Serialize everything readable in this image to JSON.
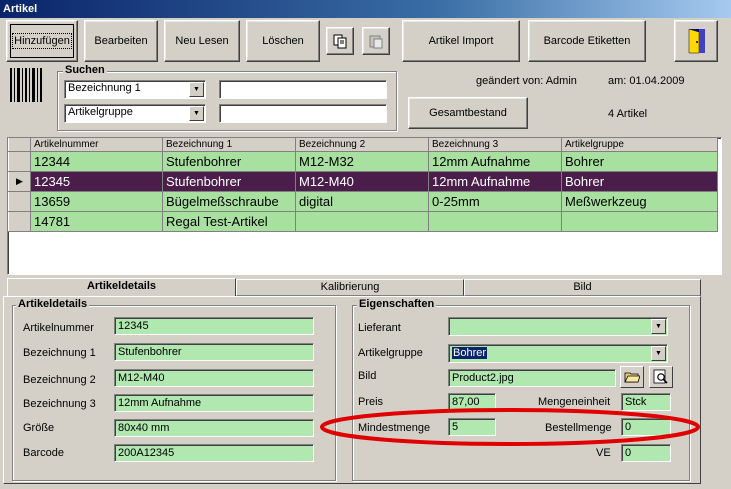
{
  "window": {
    "title": "Artikel"
  },
  "toolbar": {
    "add": "Hinzufügen",
    "edit": "Bearbeiten",
    "reload": "Neu Lesen",
    "delete": "Löschen",
    "import": "Artikel Import",
    "barcode": "Barcode Etiketten"
  },
  "search": {
    "title": "Suchen",
    "field1": "Bezeichnung 1",
    "value1": "",
    "field2": "Artikelgruppe",
    "value2": ""
  },
  "meta": {
    "changed_by": "geändert von: Admin",
    "changed_on": "am: 01.04.2009",
    "total_button": "Gesamtbestand",
    "count": "4 Artikel"
  },
  "grid": {
    "columns": [
      "Artikelnummer",
      "Bezeichnung 1",
      "Bezeichnung 2",
      "Bezeichnung 3",
      "Artikelgruppe"
    ],
    "rows": [
      [
        "12344",
        "Stufenbohrer",
        "M12-M32",
        "12mm Aufnahme",
        "Bohrer"
      ],
      [
        "12345",
        "Stufenbohrer",
        "M12-M40",
        "12mm Aufnahme",
        "Bohrer"
      ],
      [
        "13659",
        "Bügelmeßschraube",
        "digital",
        "0-25mm",
        "Meßwerkzeug"
      ],
      [
        "14781",
        "Regal Test-Artikel",
        "",
        "",
        ""
      ]
    ],
    "selected_row": 1
  },
  "tabs": [
    "Artikeldetails",
    "Kalibrierung",
    "Bild"
  ],
  "details": {
    "title": "Artikeldetails",
    "artnr_label": "Artikelnummer",
    "artnr": "12345",
    "bez1_label": "Bezeichnung 1",
    "bez1": "Stufenbohrer",
    "bez2_label": "Bezeichnung 2",
    "bez2": "M12-M40",
    "bez3_label": "Bezeichnung 3",
    "bez3": "12mm Aufnahme",
    "size_label": "Größe",
    "size": "80x40 mm",
    "barcode_label": "Barcode",
    "barcode": "200A12345"
  },
  "props": {
    "title": "Eigenschaften",
    "supplier_label": "Lieferant",
    "supplier": "",
    "group_label": "Artikelgruppe",
    "group": "Bohrer",
    "image_label": "Bild",
    "image": "Product2.jpg",
    "price_label": "Preis",
    "price": "87,00",
    "unit_label": "Mengeneinheit",
    "unit": "Stck",
    "min_label": "Mindestmenge",
    "min": "5",
    "order_label": "Bestellmenge",
    "order": "0",
    "ve_label": "VE",
    "ve": "0"
  },
  "colors": {
    "field_green": "#b0e8b0",
    "row_green": "#a8e0a0",
    "selected_row": "#4a1d4a",
    "highlight_ellipse": "#e00000"
  }
}
